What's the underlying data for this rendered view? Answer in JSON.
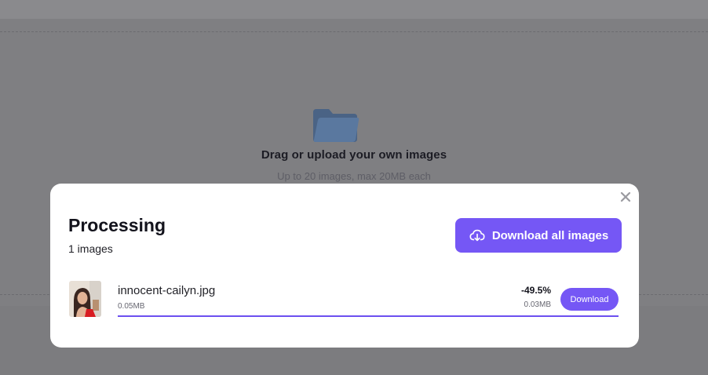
{
  "dropzone": {
    "title": "Drag or upload your own images",
    "subtitle": "Up to 20 images, max 20MB each",
    "icon": "folder-icon"
  },
  "modal": {
    "title": "Processing",
    "count": "1 images",
    "download_all_label": "Download all images",
    "close_icon": "close-icon",
    "files": [
      {
        "name": "innocent-cailyn.jpg",
        "original_size": "0.05MB",
        "reduction": "-49.5%",
        "new_size": "0.03MB",
        "download_label": "Download",
        "progress": 1.0
      }
    ]
  },
  "colors": {
    "accent": "#7557f5",
    "overlay": "#7c7c7f",
    "folder": "#56729a"
  }
}
